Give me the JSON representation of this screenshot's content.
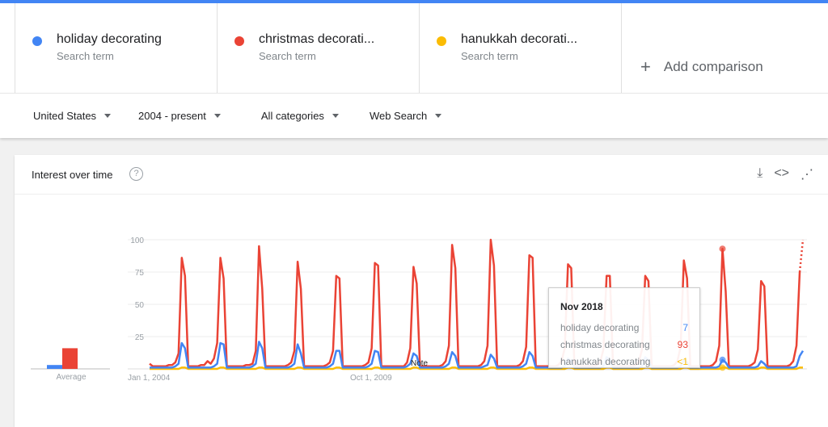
{
  "colors": {
    "holiday": "#4285f4",
    "christmas": "#ea4335",
    "hanukkah": "#fbbc04",
    "accent": "#4285f4"
  },
  "terms": [
    {
      "name": "holiday decorating",
      "sub": "Search term",
      "color": "#4285f4"
    },
    {
      "name": "christmas decorati...",
      "sub": "Search term",
      "color": "#ea4335"
    },
    {
      "name": "hanukkah decorati...",
      "sub": "Search term",
      "color": "#fbbc04"
    }
  ],
  "add_comparison": "Add comparison",
  "filters": [
    "United States",
    "2004 - present",
    "All categories",
    "Web Search"
  ],
  "card": {
    "title": "Interest over time",
    "help": "?",
    "icons": [
      "download-icon",
      "embed-icon",
      "share-icon"
    ]
  },
  "tooltip": {
    "date": "Nov 2018",
    "rows": [
      {
        "label": "holiday decorating",
        "value": "7"
      },
      {
        "label": "christmas decorating",
        "value": "93"
      },
      {
        "label": "hanukkah decorating",
        "value": "<1"
      }
    ]
  },
  "chart_data": {
    "type": "line",
    "start": "Jan 2004",
    "frequency": "monthly",
    "ylim": [
      0,
      100
    ],
    "yticks": [
      25,
      50,
      75,
      100
    ],
    "xtick_labels": [
      "Jan 1, 2004",
      "Oct 1, 2009"
    ],
    "note_label": "Note",
    "grid": true,
    "average": {
      "label": "Average",
      "values": {
        "holiday decorating": 3,
        "christmas decorating": 16,
        "hanukkah decorating": 0
      }
    },
    "series": [
      {
        "name": "holiday decorating",
        "color": "#4285f4",
        "by_year": [
          [
            1,
            1,
            1,
            1,
            1,
            1,
            1,
            1,
            2,
            4,
            20,
            16
          ],
          [
            1,
            1,
            1,
            1,
            1,
            1,
            1,
            1,
            2,
            4,
            20,
            19
          ],
          [
            1,
            1,
            1,
            1,
            1,
            1,
            1,
            1,
            2,
            4,
            21,
            16
          ],
          [
            1,
            1,
            1,
            1,
            1,
            1,
            1,
            1,
            2,
            4,
            19,
            12
          ],
          [
            1,
            1,
            1,
            1,
            1,
            1,
            1,
            1,
            2,
            4,
            14,
            14
          ],
          [
            1,
            1,
            1,
            1,
            1,
            1,
            1,
            1,
            2,
            4,
            14,
            13
          ],
          [
            1,
            1,
            1,
            1,
            1,
            1,
            1,
            1,
            2,
            4,
            12,
            10
          ],
          [
            1,
            1,
            1,
            1,
            1,
            1,
            1,
            1,
            2,
            4,
            13,
            10
          ],
          [
            1,
            1,
            1,
            1,
            1,
            1,
            1,
            1,
            2,
            3,
            11,
            8
          ],
          [
            1,
            1,
            1,
            1,
            1,
            1,
            1,
            1,
            2,
            4,
            13,
            10
          ],
          [
            1,
            1,
            1,
            1,
            1,
            1,
            1,
            1,
            1,
            2,
            8,
            6
          ],
          [
            1,
            1,
            1,
            1,
            1,
            1,
            1,
            1,
            1,
            2,
            9,
            7
          ],
          [
            1,
            1,
            1,
            1,
            1,
            1,
            1,
            1,
            1,
            2,
            9,
            7
          ],
          [
            1,
            1,
            1,
            1,
            1,
            1,
            1,
            1,
            1,
            2,
            7,
            5
          ],
          [
            1,
            1,
            1,
            1,
            1,
            1,
            1,
            1,
            1,
            2,
            7,
            5
          ],
          [
            1,
            1,
            1,
            1,
            1,
            1,
            1,
            1,
            1,
            2,
            6,
            4
          ],
          [
            1,
            1,
            1,
            1,
            1,
            1,
            1,
            1,
            1,
            2,
            10,
            14
          ]
        ]
      },
      {
        "name": "christmas decorating",
        "color": "#ea4335",
        "by_year": [
          [
            4,
            2,
            2,
            2,
            2,
            2,
            3,
            3,
            5,
            12,
            86,
            72
          ],
          [
            2,
            2,
            2,
            2,
            3,
            3,
            6,
            4,
            8,
            20,
            86,
            70
          ],
          [
            2,
            2,
            2,
            2,
            2,
            2,
            3,
            3,
            4,
            14,
            95,
            62
          ],
          [
            2,
            2,
            2,
            2,
            2,
            2,
            2,
            3,
            5,
            14,
            83,
            62
          ],
          [
            2,
            2,
            2,
            2,
            2,
            2,
            2,
            3,
            5,
            14,
            72,
            70
          ],
          [
            2,
            2,
            2,
            2,
            2,
            2,
            2,
            3,
            5,
            16,
            82,
            80
          ],
          [
            2,
            2,
            2,
            2,
            2,
            2,
            2,
            2,
            5,
            16,
            79,
            66
          ],
          [
            2,
            2,
            2,
            2,
            2,
            2,
            2,
            3,
            6,
            18,
            96,
            78
          ],
          [
            2,
            2,
            2,
            2,
            2,
            2,
            2,
            3,
            6,
            18,
            100,
            80
          ],
          [
            2,
            2,
            2,
            2,
            2,
            2,
            2,
            3,
            6,
            17,
            88,
            86
          ],
          [
            2,
            2,
            2,
            2,
            2,
            2,
            2,
            3,
            6,
            16,
            81,
            78
          ],
          [
            2,
            2,
            2,
            2,
            2,
            2,
            2,
            3,
            5,
            15,
            72,
            72
          ],
          [
            2,
            2,
            2,
            2,
            2,
            2,
            2,
            3,
            5,
            15,
            72,
            68
          ],
          [
            2,
            2,
            2,
            2,
            2,
            2,
            2,
            3,
            6,
            17,
            84,
            70
          ],
          [
            2,
            2,
            2,
            2,
            2,
            2,
            2,
            3,
            6,
            18,
            93,
            60
          ],
          [
            2,
            2,
            2,
            2,
            2,
            2,
            2,
            3,
            5,
            15,
            68,
            64
          ],
          [
            2,
            2,
            2,
            2,
            2,
            2,
            2,
            3,
            6,
            18,
            75,
            100
          ]
        ],
        "partial_last": true
      },
      {
        "name": "hanukkah decorating",
        "color": "#fbbc04",
        "by_year": [
          [
            0,
            0,
            0,
            0,
            0,
            0,
            0,
            0,
            0,
            0,
            1,
            1
          ],
          [
            0,
            0,
            0,
            0,
            0,
            0,
            0,
            0,
            0,
            0,
            1,
            1
          ],
          [
            0,
            0,
            0,
            0,
            0,
            0,
            0,
            0,
            0,
            0,
            1,
            1
          ],
          [
            0,
            0,
            0,
            0,
            0,
            0,
            0,
            0,
            0,
            0,
            1,
            1
          ],
          [
            0,
            0,
            0,
            0,
            0,
            0,
            0,
            0,
            0,
            0,
            1,
            1
          ],
          [
            0,
            0,
            0,
            0,
            0,
            0,
            0,
            0,
            0,
            0,
            1,
            1
          ],
          [
            0,
            0,
            0,
            0,
            0,
            0,
            0,
            0,
            0,
            0,
            1,
            1
          ],
          [
            0,
            0,
            0,
            0,
            0,
            0,
            0,
            0,
            0,
            0,
            1,
            1
          ],
          [
            0,
            0,
            0,
            0,
            0,
            0,
            0,
            0,
            0,
            0,
            1,
            1
          ],
          [
            0,
            0,
            0,
            0,
            0,
            0,
            0,
            0,
            0,
            0,
            1,
            1
          ],
          [
            0,
            0,
            0,
            0,
            0,
            0,
            0,
            0,
            0,
            0,
            1,
            1
          ],
          [
            0,
            0,
            0,
            0,
            0,
            0,
            0,
            0,
            0,
            0,
            1,
            1
          ],
          [
            0,
            0,
            0,
            0,
            0,
            0,
            0,
            0,
            0,
            0,
            1,
            1
          ],
          [
            0,
            0,
            0,
            0,
            0,
            0,
            0,
            0,
            0,
            0,
            1,
            1
          ],
          [
            0,
            0,
            0,
            0,
            0,
            0,
            0,
            0,
            0,
            0,
            1,
            1
          ],
          [
            0,
            0,
            0,
            0,
            0,
            0,
            0,
            0,
            0,
            0,
            1,
            1
          ],
          [
            0,
            0,
            0,
            0,
            0,
            0,
            0,
            0,
            0,
            0,
            1,
            1
          ]
        ]
      }
    ],
    "highlight": {
      "date": "Nov 2018"
    }
  }
}
